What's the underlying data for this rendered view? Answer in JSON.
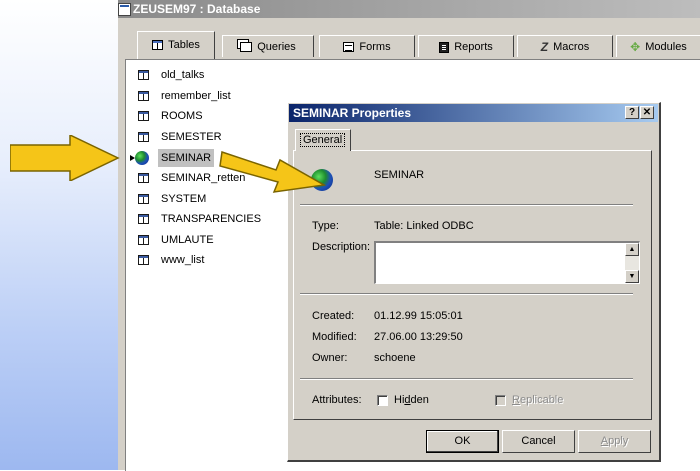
{
  "window": {
    "title": "ZEUSEM97 : Database"
  },
  "tabs": [
    {
      "label": "Tables",
      "icon": "table-icon",
      "active": true
    },
    {
      "label": "Queries",
      "icon": "query-icon",
      "active": false
    },
    {
      "label": "Forms",
      "icon": "form-icon",
      "active": false
    },
    {
      "label": "Reports",
      "icon": "report-icon",
      "active": false
    },
    {
      "label": "Macros",
      "icon": "macro-icon",
      "active": false
    },
    {
      "label": "Modules",
      "icon": "module-icon",
      "active": false
    }
  ],
  "tables": [
    {
      "name": "old_talks",
      "icon": "table-icon"
    },
    {
      "name": "remember_list",
      "icon": "table-icon"
    },
    {
      "name": "ROOMS",
      "icon": "table-icon"
    },
    {
      "name": "SEMESTER",
      "icon": "table-icon"
    },
    {
      "name": "SEMINAR",
      "icon": "linked-table-globe-icon",
      "selected": true
    },
    {
      "name": "SEMINAR_retten",
      "icon": "table-icon"
    },
    {
      "name": "SYSTEM",
      "icon": "table-icon"
    },
    {
      "name": "TRANSPARENCIES",
      "icon": "table-icon"
    },
    {
      "name": "UMLAUTE",
      "icon": "table-icon"
    },
    {
      "name": "www_list",
      "icon": "table-icon"
    }
  ],
  "dialog": {
    "title": "SEMINAR Properties",
    "help_button": "?",
    "close_button": "✕",
    "tab": "General",
    "object_name": "SEMINAR",
    "type_label": "Type:",
    "type_value": "Table: Linked ODBC",
    "description_label": "Description:",
    "description_value": "",
    "created_label": "Created:",
    "created_value": "01.12.99 15:05:01",
    "modified_label": "Modified:",
    "modified_value": "27.06.00 13:29:50",
    "owner_label": "Owner:",
    "owner_value": "schoene",
    "attributes_label": "Attributes:",
    "hidden_label": "Hidden",
    "hidden_checked": false,
    "replicable_label": "Replicable",
    "replicable_checked": false,
    "replicable_enabled": false,
    "ok_button": "OK",
    "cancel_button": "Cancel",
    "apply_button": "Apply",
    "apply_enabled": false
  },
  "annotations": {
    "arrow_color": "#f5c518",
    "arrow_outline": "#7a6400"
  },
  "colors": {
    "dialog_titlebar_start": "#0a246a",
    "dialog_titlebar_end": "#a6caf0",
    "window_titlebar_inactive": "#8a8a8a",
    "button_face": "#d4d0c8",
    "selected_item": "#c0c0c0"
  }
}
